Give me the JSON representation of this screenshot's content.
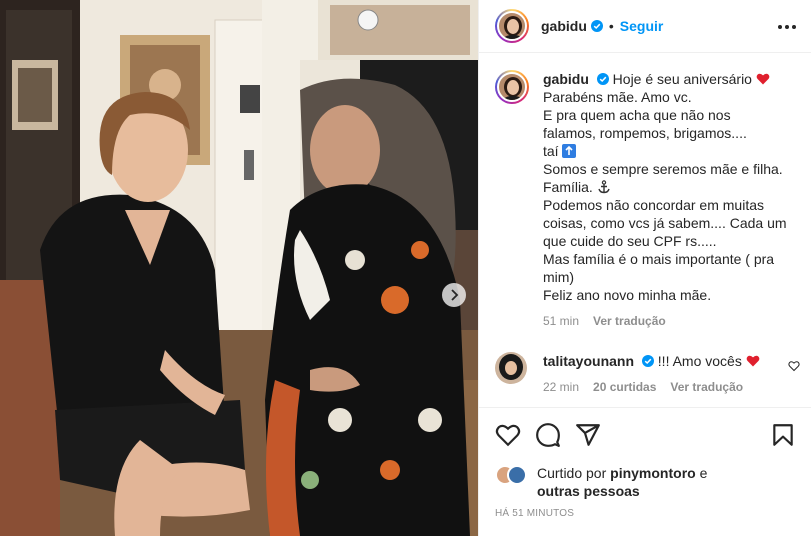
{
  "header": {
    "username": "gabidu",
    "separator": "•",
    "follow_label": "Seguir"
  },
  "caption": {
    "username": "gabidu",
    "lines": [
      "Hoje é seu aniversário",
      "Parabéns mãe. Amo vc.",
      "E pra quem acha que não nos",
      "falamos, rompemos, brigamos....",
      "taí",
      "Somos e sempre seremos mãe e filha.",
      "Família.",
      "Podemos não concordar em muitas",
      "coisas, como vcs já sabem.... Cada um",
      "que cuide do seu CPF rs.....",
      "Mas família é o mais importante ( pra",
      "mim)",
      "Feliz ano novo minha mãe."
    ],
    "time": "51 min",
    "translate_label": "Ver tradução"
  },
  "comment": {
    "username": "talitayounann",
    "text": "!!! Amo vocês",
    "time": "22 min",
    "likes": "20 curtidas",
    "translate_label": "Ver tradução"
  },
  "likes": {
    "prefix": "Curtido por",
    "user": "pinymontoro",
    "conjunction": "e",
    "others": "outras pessoas"
  },
  "timestamp": "HÁ 51 MINUTOS",
  "icons": {
    "verified": "verified-badge-icon",
    "heart": "heart-icon",
    "comment": "comment-icon",
    "share": "share-icon",
    "save": "bookmark-icon",
    "more": "more-options-icon",
    "next": "chevron-right-icon"
  },
  "colors": {
    "accent": "#0095f6",
    "text": "#262626",
    "muted": "#8e8e8e",
    "heart": "#ed4956"
  }
}
